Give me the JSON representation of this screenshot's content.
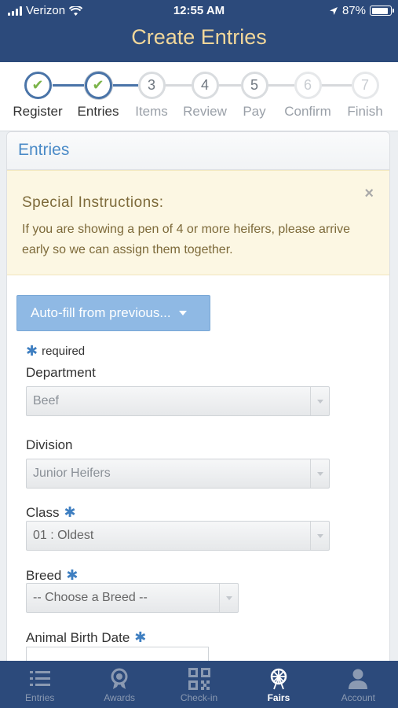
{
  "status_bar": {
    "carrier": "Verizon",
    "time": "12:55 AM",
    "battery": "87%"
  },
  "header": {
    "title": "Create Entries"
  },
  "steps": [
    {
      "label": "Register",
      "number": "1",
      "state": "done"
    },
    {
      "label": "Entries",
      "number": "2",
      "state": "current"
    },
    {
      "label": "Items",
      "number": "3",
      "state": "next"
    },
    {
      "label": "Review",
      "number": "4",
      "state": "next"
    },
    {
      "label": "Pay",
      "number": "5",
      "state": "next"
    },
    {
      "label": "Confirm",
      "number": "6",
      "state": "muted"
    },
    {
      "label": "Finish",
      "number": "7",
      "state": "muted"
    }
  ],
  "panel": {
    "title": "Entries",
    "notice": {
      "heading": "Special Instructions:",
      "body": "If you are showing a pen of 4 or more heifers, please arrive early so we can assign them together.",
      "close": "×"
    },
    "autofill_label": "Auto-fill from previous...",
    "required_note": "required",
    "fields": {
      "department": {
        "label": "Department",
        "value": "Beef"
      },
      "division": {
        "label": "Division",
        "value": "Junior Heifers"
      },
      "class": {
        "label": "Class",
        "value": "01 : Oldest"
      },
      "breed": {
        "label": "Breed",
        "value": "-- Choose a Breed --"
      },
      "birth_date": {
        "label": "Animal Birth Date",
        "value": ""
      }
    }
  },
  "tabs": [
    {
      "label": "Entries",
      "icon": "list-icon",
      "active": false
    },
    {
      "label": "Awards",
      "icon": "ribbon-icon",
      "active": false
    },
    {
      "label": "Check-in",
      "icon": "qr-code-icon",
      "active": false
    },
    {
      "label": "Fairs",
      "icon": "ferris-wheel-icon",
      "active": true
    },
    {
      "label": "Account",
      "icon": "person-icon",
      "active": false
    }
  ],
  "colors": {
    "header": "#2c4a7b",
    "title": "#f1d79a",
    "accent": "#4a8ac7",
    "check": "#7cb44a"
  }
}
